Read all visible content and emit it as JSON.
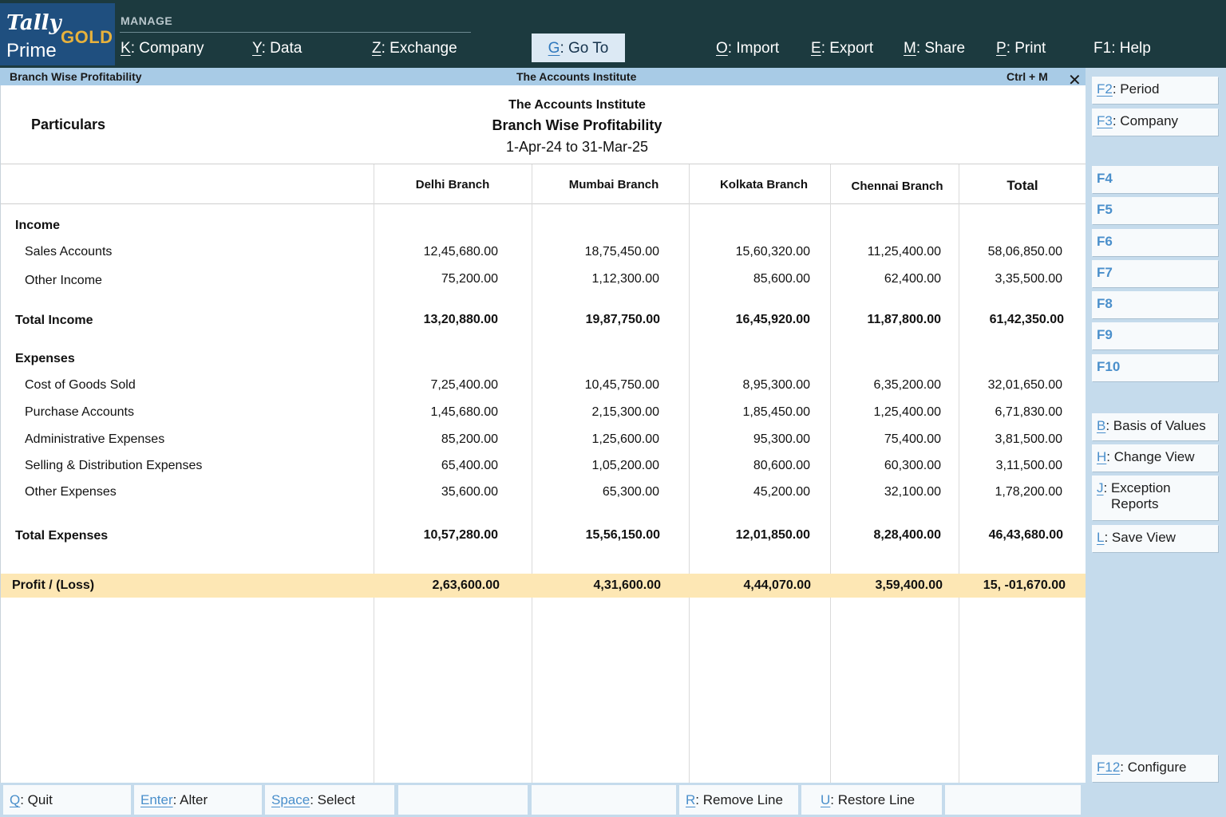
{
  "logo": {
    "tally": "Tally",
    "gold": "GOLD",
    "prime": "Prime"
  },
  "menu": {
    "section_label": "MANAGE",
    "items": [
      {
        "key": "K",
        "label": ": Company"
      },
      {
        "key": "Y",
        "label": ": Data"
      },
      {
        "key": "Z",
        "label": ": Exchange"
      },
      {
        "key": "G",
        "label": ": Go To"
      },
      {
        "key": "O",
        "label": ": Import"
      },
      {
        "key": "E",
        "label": ": Export"
      },
      {
        "key": "M",
        "label": ": Share"
      },
      {
        "key": "P",
        "label": ": Print"
      },
      {
        "key": "F1",
        "label": ": Help"
      }
    ]
  },
  "titlebar": {
    "report_name": "Branch Wise Profitability",
    "company": "The Accounts Institute",
    "shortcut": "Ctrl + M",
    "close_glyph": "✕"
  },
  "report": {
    "particulars_label": "Particulars",
    "company": "The Accounts Institute",
    "title": "Branch Wise Profitability",
    "period": "1-Apr-24 to 31-Mar-25",
    "columns": [
      "Delhi Branch",
      "Mumbai Branch",
      "Kolkata Branch",
      "Chennai Branch",
      "Total"
    ],
    "income_heading": "Income",
    "income_rows": [
      {
        "label": "Sales Accounts",
        "values": [
          "12,45,680.00",
          "18,75,450.00",
          "15,60,320.00",
          "11,25,400.00",
          "58,06,850.00"
        ]
      },
      {
        "label": "Other Income",
        "values": [
          "75,200.00",
          "1,12,300.00",
          "85,600.00",
          "62,400.00",
          "3,35,500.00"
        ]
      }
    ],
    "total_income": {
      "label": "Total Income",
      "values": [
        "13,20,880.00",
        "19,87,750.00",
        "16,45,920.00",
        "11,87,800.00",
        "61,42,350.00"
      ]
    },
    "expenses_heading": "Expenses",
    "expense_rows": [
      {
        "label": "Cost of Goods Sold",
        "values": [
          "7,25,400.00",
          "10,45,750.00",
          "8,95,300.00",
          "6,35,200.00",
          "32,01,650.00"
        ]
      },
      {
        "label": "Purchase Accounts",
        "values": [
          "1,45,680.00",
          "2,15,300.00",
          "1,85,450.00",
          "1,25,400.00",
          "6,71,830.00"
        ]
      },
      {
        "label": "Administrative Expenses",
        "values": [
          "85,200.00",
          "1,25,600.00",
          "95,300.00",
          "75,400.00",
          "3,81,500.00"
        ]
      },
      {
        "label": "Selling & Distribution Expenses",
        "values": [
          "65,400.00",
          "1,05,200.00",
          "80,600.00",
          "60,300.00",
          "3,11,500.00"
        ]
      },
      {
        "label": "Other Expenses",
        "values": [
          "35,600.00",
          "65,300.00",
          "45,200.00",
          "32,100.00",
          "1,78,200.00"
        ]
      }
    ],
    "total_expenses": {
      "label": "Total Expenses",
      "values": [
        "10,57,280.00",
        "15,56,150.00",
        "12,01,850.00",
        "8,28,400.00",
        "46,43,680.00"
      ]
    },
    "profit": {
      "label": "Profit / (Loss)",
      "values": [
        "2,63,600.00",
        "4,31,600.00",
        "4,44,070.00",
        "3,59,400.00",
        "15, -01,670.00"
      ]
    }
  },
  "right_panel": [
    {
      "key": "F2",
      "label": ": Period"
    },
    {
      "key": "F3",
      "label": ": Company"
    },
    {
      "key": "F4",
      "label": ""
    },
    {
      "key": "F5",
      "label": ""
    },
    {
      "key": "F6",
      "label": ""
    },
    {
      "key": "F7",
      "label": ""
    },
    {
      "key": "F8",
      "label": ""
    },
    {
      "key": "F9",
      "label": ""
    },
    {
      "key": "F10",
      "label": ""
    },
    {
      "key": "B",
      "label": ": Basis of Values"
    },
    {
      "key": "H",
      "label": ": Change View"
    },
    {
      "key": "J",
      "label": ": Exception",
      "label2": "Reports"
    },
    {
      "key": "L",
      "label": ": Save View"
    },
    {
      "key": "F12",
      "label": ": Configure"
    }
  ],
  "bottom_bar": [
    {
      "key": "Q",
      "label": ": Quit"
    },
    {
      "key": "Enter",
      "label": ": Alter"
    },
    {
      "key": "Space",
      "label": ": Select"
    },
    {
      "key": "",
      "label": ""
    },
    {
      "key": "",
      "label": ""
    },
    {
      "key": "R",
      "label": ": Remove Line"
    },
    {
      "key": "U",
      "label": ": Restore Line"
    },
    {
      "key": "",
      "label": ""
    }
  ],
  "colors": {
    "topbar": "#1c3a3f",
    "accent": "#4a8fcb",
    "profit_band": "#fde7b4",
    "gold": "#e8b23c"
  }
}
